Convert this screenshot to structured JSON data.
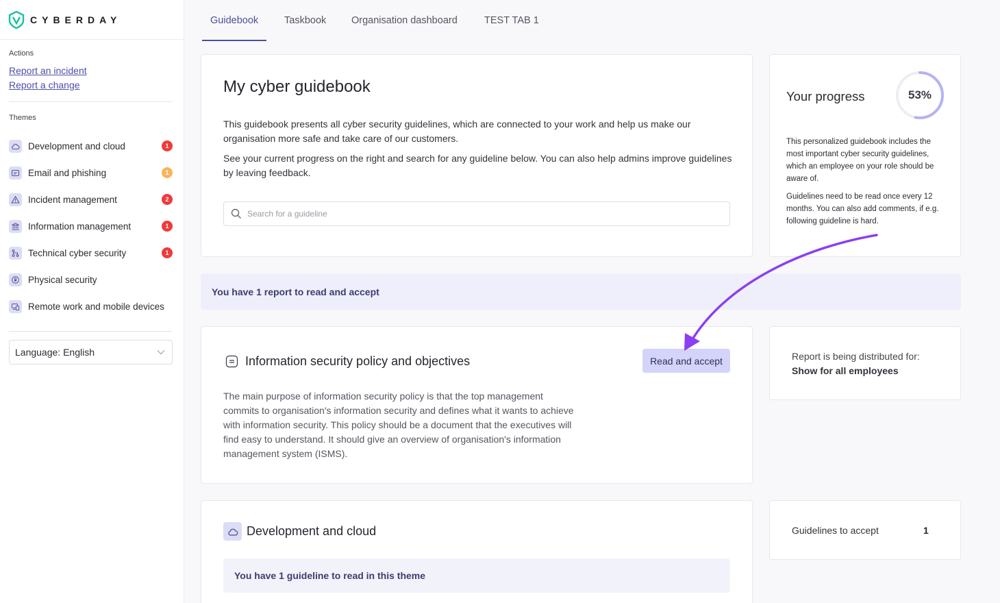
{
  "brand": {
    "name": "CYBERDAY",
    "accent": "#4d4e9a",
    "logo_color": "#18c2a3"
  },
  "sidebar": {
    "actions_label": "Actions",
    "actions": [
      "Report an incident",
      "Report a change"
    ],
    "themes_label": "Themes",
    "themes": [
      {
        "label": "Development and cloud",
        "icon": "cloud-icon",
        "badge": "1",
        "badge_color": "#ef3b3b"
      },
      {
        "label": "Email and phishing",
        "icon": "mail-icon",
        "badge": "1",
        "badge_color": "#f6b55b"
      },
      {
        "label": "Incident management",
        "icon": "warning-icon",
        "badge": "2",
        "badge_color": "#ef3b3b"
      },
      {
        "label": "Information management",
        "icon": "bank-icon",
        "badge": "1",
        "badge_color": "#ef3b3b"
      },
      {
        "label": "Technical cyber security",
        "icon": "network-icon",
        "badge": "1",
        "badge_color": "#ef3b3b"
      },
      {
        "label": "Physical security",
        "icon": "lock-badge-icon",
        "badge": "",
        "badge_color": ""
      },
      {
        "label": "Remote work and mobile devices",
        "icon": "devices-icon",
        "badge": "",
        "badge_color": ""
      }
    ],
    "language": "Language: English"
  },
  "nav": {
    "tabs": [
      "Guidebook",
      "Taskbook",
      "Organisation dashboard",
      "TEST TAB 1"
    ],
    "active": "Guidebook"
  },
  "hero": {
    "title": "My cyber guidebook",
    "p1": "This guidebook presents all cyber security guidelines, which are connected to your work and help us make our organisation more safe and take care of our customers.",
    "p2": "See your current progress on the right and search for any guideline below. You can also help admins improve guidelines by leaving feedback.",
    "search_placeholder": "Search for a guideline"
  },
  "progress": {
    "title": "Your progress",
    "percent_label": "53%",
    "percent_value": 0.53,
    "p1": "This personalized guidebook includes the most important cyber security guidelines, which an employee on your role should be aware of.",
    "p2": "Guidelines need to be read once every 12 months. You can also add comments, if e.g. following guideline is hard."
  },
  "report_banner": "You have 1 report to read and accept",
  "report": {
    "title": "Information security policy and objectives",
    "button": "Read and accept",
    "body": "The main purpose of information security policy is that the top management commits to organisation's information security and defines what it wants to achieve with information security. This policy should be a document that the executives will find easy to understand. It should give an overview of organisation's information management system (ISMS).",
    "distribution_label": "Report is being distributed for:",
    "distribution_value": "Show for all employees"
  },
  "theme_section": {
    "title": "Development and cloud",
    "banner": "You have 1 guideline to read in this theme",
    "stat_label": "Guidelines to accept",
    "stat_value": "1"
  },
  "annotation": {
    "arrow_color": "#8a3ff0"
  }
}
